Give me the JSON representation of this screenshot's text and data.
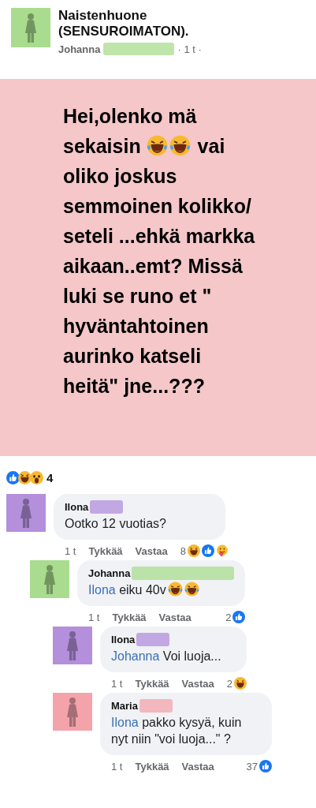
{
  "post": {
    "group": "Naistenhuone (SENSUROIMATON).",
    "author": "Johanna",
    "color": "#a9dc8e",
    "time": "· 1 t ·",
    "body": [
      {
        "kind": "text",
        "text": "Hei,olenko mä sekaisin"
      },
      {
        "kind": "tears"
      },
      {
        "kind": "tears"
      },
      {
        "kind": "text",
        "text": "vai oliko joskus semmoinen kolikko/ seteli ...ehkä markka aikaan..emt? Missä luki se runo et \" hyväntahtoinen aurinko katseli heitä\" jne...???"
      }
    ],
    "reactions": [
      {
        "kind": "like"
      },
      {
        "kind": "haha"
      },
      {
        "kind": "wow"
      }
    ],
    "reaction_count": "4"
  },
  "comments": [
    {
      "author": "Ilona",
      "color": "#b38fdc",
      "text": "Ootko 12 vuotias?",
      "time": "1 t",
      "like": "Tykkää",
      "reply": "Vastaa",
      "count": "8",
      "reactions": [
        {
          "kind": "haha"
        },
        {
          "kind": "like"
        },
        {
          "kind": "care"
        }
      ],
      "children": [
        {
          "author": "Johanna",
          "color": "#a9dc8e",
          "mention": "Ilona",
          "text": "eiku 40v",
          "emojis": [
            {
              "kind": "tears"
            },
            {
              "kind": "tears"
            }
          ],
          "time": "1 t",
          "like": "Tykkää",
          "reply": "Vastaa",
          "count": "2",
          "reactions": [
            {
              "kind": "like"
            }
          ],
          "children": [
            {
              "author": "Ilona",
              "color": "#b38fdc",
              "mention": "Johanna",
              "text": "Voi luoja...",
              "time": "1 t",
              "like": "Tykkää",
              "reply": "Vastaa",
              "count": "2",
              "reactions": [
                {
                  "kind": "haha"
                }
              ]
            },
            {
              "author": "Maria",
              "color": "#f4a3ab",
              "mention": "Ilona",
              "text": "pakko kysyä, kuin nyt niin \"voi luoja...\" ?",
              "time": "1 t",
              "like": "Tykkää",
              "reply": "Vastaa",
              "count": "37",
              "reactions": [
                {
                  "kind": "like"
                }
              ]
            }
          ]
        }
      ]
    }
  ]
}
